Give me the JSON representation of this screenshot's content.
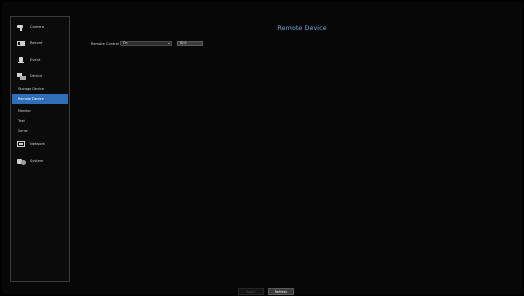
{
  "page": {
    "title": "Remote Device"
  },
  "sidebar": {
    "items": [
      {
        "label": "Camera",
        "icon": "camera-icon"
      },
      {
        "label": "Record",
        "icon": "record-icon"
      },
      {
        "label": "Event",
        "icon": "event-icon"
      },
      {
        "label": "Device",
        "icon": "device-icon"
      },
      {
        "label": "Storage Device",
        "sub": true
      },
      {
        "label": "Remote Device",
        "sub": true,
        "active": true
      },
      {
        "label": "Monitor",
        "sub": true
      },
      {
        "label": "Text",
        "sub": true
      },
      {
        "label": "Serial",
        "sub": true
      },
      {
        "label": "Network",
        "icon": "network-icon"
      },
      {
        "label": "System",
        "icon": "system-icon"
      }
    ]
  },
  "remote_control": {
    "label": "Remote Control",
    "value": "On",
    "id_button": "ID 0"
  },
  "footer": {
    "apply_label": "Apply",
    "refresh_label": "Refresh"
  },
  "colors": {
    "accent": "#2f6fb8",
    "title": "#6fa4d8",
    "background": "#070707"
  }
}
